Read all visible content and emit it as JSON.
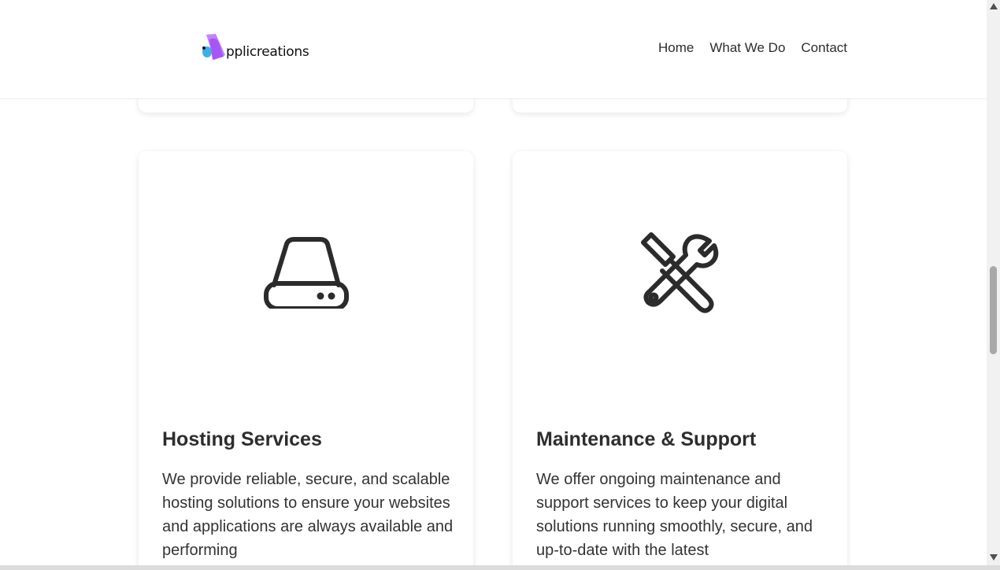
{
  "brand": {
    "name": "pplicreations",
    "logo_letter": "A"
  },
  "nav": {
    "items": [
      "Home",
      "What We Do",
      "Contact"
    ]
  },
  "services": [
    {
      "title": "Hosting Services",
      "icon": "server-drive-icon",
      "description": "We provide reliable, secure, and scalable hosting solutions to ensure your websites and applications are always available and performing"
    },
    {
      "title": "Maintenance & Support",
      "icon": "tools-icon",
      "description": "We offer ongoing maintenance and support services to keep your digital solutions running smoothly, secure, and up-to-date with the latest"
    }
  ],
  "colors": {
    "logo_purple": "#a855f7",
    "logo_blue": "#3bb0e8",
    "icon_dark": "#2b2b2b"
  }
}
